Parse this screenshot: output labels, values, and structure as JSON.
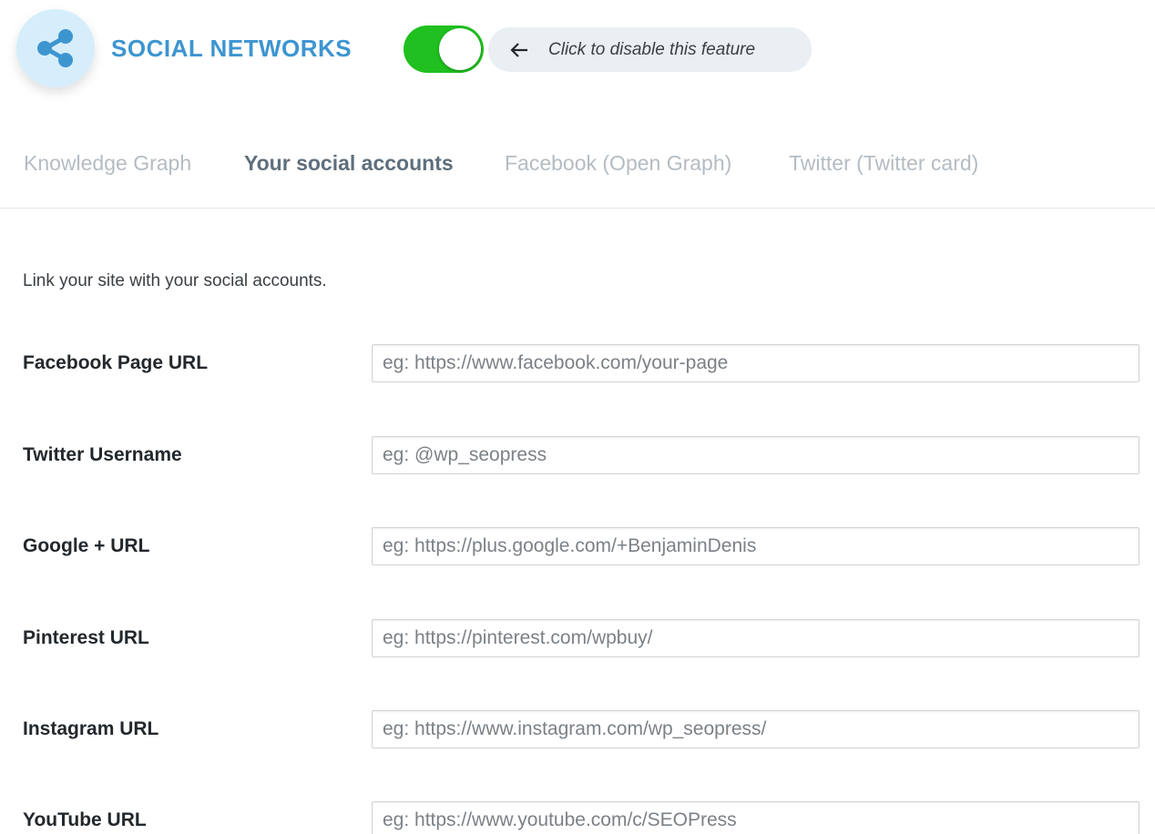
{
  "header": {
    "title": "SOCIAL NETWORKS",
    "toggle_on": true,
    "toggle_hint": "Click to disable this feature",
    "accent_color": "#3d95d0",
    "toggle_color": "#1fc01f",
    "icons": {
      "badge": "share-icon",
      "hint": "arrow-left-icon"
    }
  },
  "tabs": [
    {
      "label": "Knowledge Graph",
      "active": false
    },
    {
      "label": "Your social accounts",
      "active": true
    },
    {
      "label": "Facebook (Open Graph)",
      "active": false
    },
    {
      "label": "Twitter (Twitter card)",
      "active": false
    }
  ],
  "content": {
    "intro": "Link your site with your social accounts.",
    "fields": [
      {
        "label": "Facebook Page URL",
        "placeholder": "eg: https://www.facebook.com/your-page",
        "value": ""
      },
      {
        "label": "Twitter Username",
        "placeholder": "eg: @wp_seopress",
        "value": ""
      },
      {
        "label": "Google + URL",
        "placeholder": "eg: https://plus.google.com/+BenjaminDenis",
        "value": ""
      },
      {
        "label": "Pinterest URL",
        "placeholder": "eg: https://pinterest.com/wpbuy/",
        "value": ""
      },
      {
        "label": "Instagram URL",
        "placeholder": "eg: https://www.instagram.com/wp_seopress/",
        "value": ""
      },
      {
        "label": "YouTube URL",
        "placeholder": "eg: https://www.youtube.com/c/SEOPress",
        "value": ""
      }
    ]
  }
}
